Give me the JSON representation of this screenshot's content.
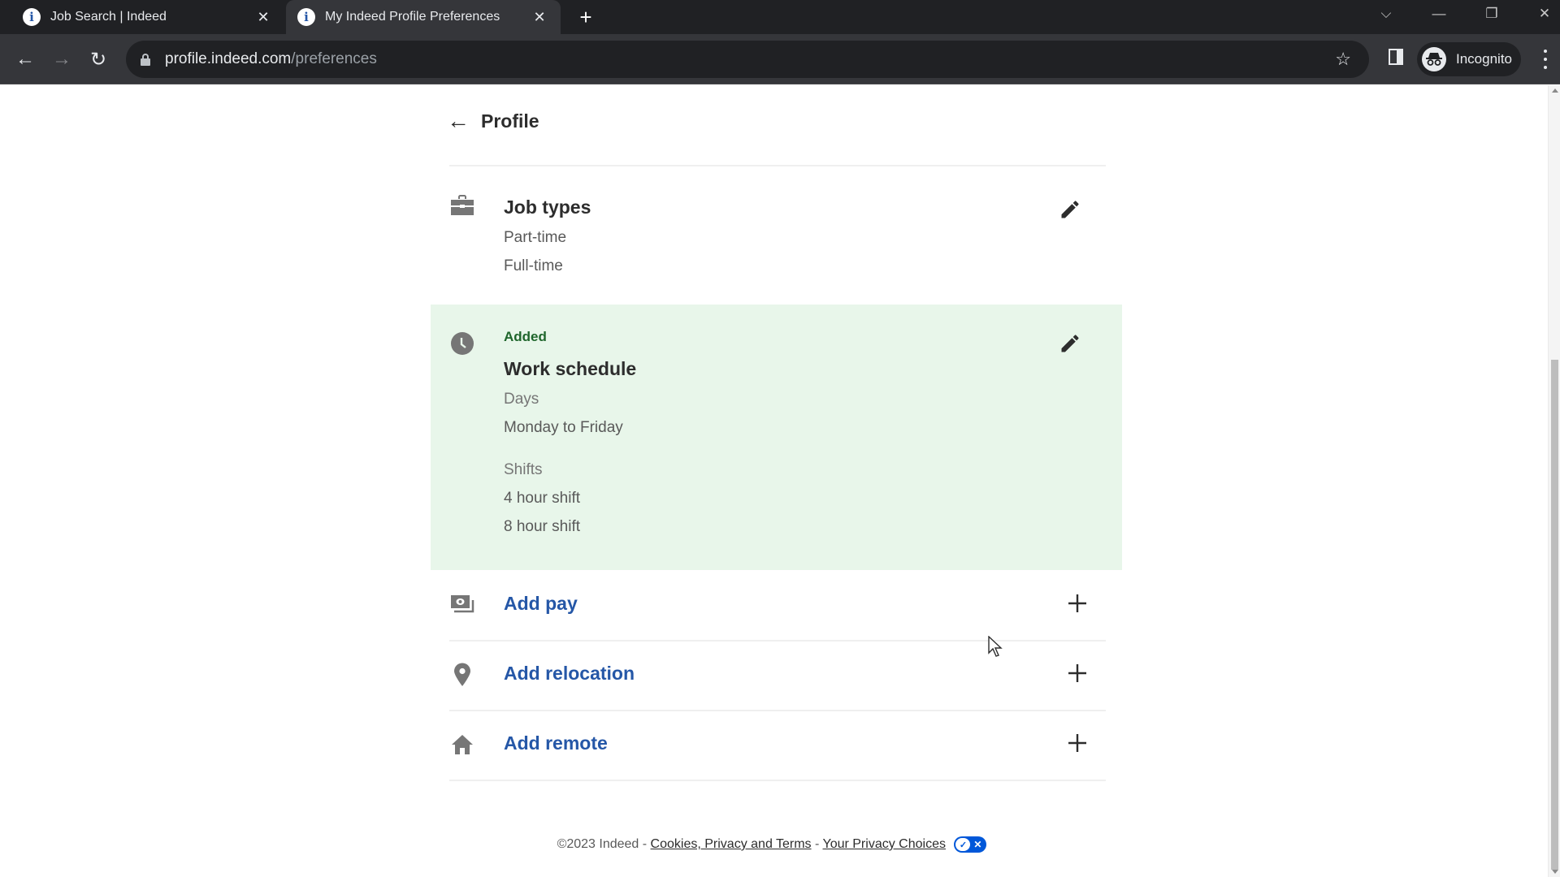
{
  "browser": {
    "tabs": [
      {
        "title": "Job Search | Indeed",
        "favicon": "indeed-icon",
        "active": false
      },
      {
        "title": "My Indeed Profile Preferences",
        "favicon": "indeed-icon",
        "active": true
      }
    ],
    "new_tab_label": "+",
    "address": {
      "domain": "profile.indeed.com",
      "path": "/preferences"
    },
    "profile_label": "Incognito"
  },
  "page": {
    "back_label": "Profile",
    "sections": {
      "job_types": {
        "title": "Job types",
        "values": [
          "Part-time",
          "Full-time"
        ]
      },
      "work_schedule": {
        "status": "Added",
        "title": "Work schedule",
        "days_label": "Days",
        "days": [
          "Monday to Friday"
        ],
        "shifts_label": "Shifts",
        "shifts": [
          "4 hour shift",
          "8 hour shift"
        ],
        "highlight_color": "#e8f6ea"
      }
    },
    "add_rows": [
      {
        "label": "Add pay",
        "icon": "money-icon"
      },
      {
        "label": "Add relocation",
        "icon": "location-pin-icon"
      },
      {
        "label": "Add remote",
        "icon": "home-icon"
      }
    ],
    "accent_color": "#2557a7"
  },
  "footer": {
    "copyright": "©2023 Indeed",
    "separator": " - ",
    "links": [
      "Cookies, Privacy and Terms",
      "Your Privacy Choices"
    ]
  }
}
